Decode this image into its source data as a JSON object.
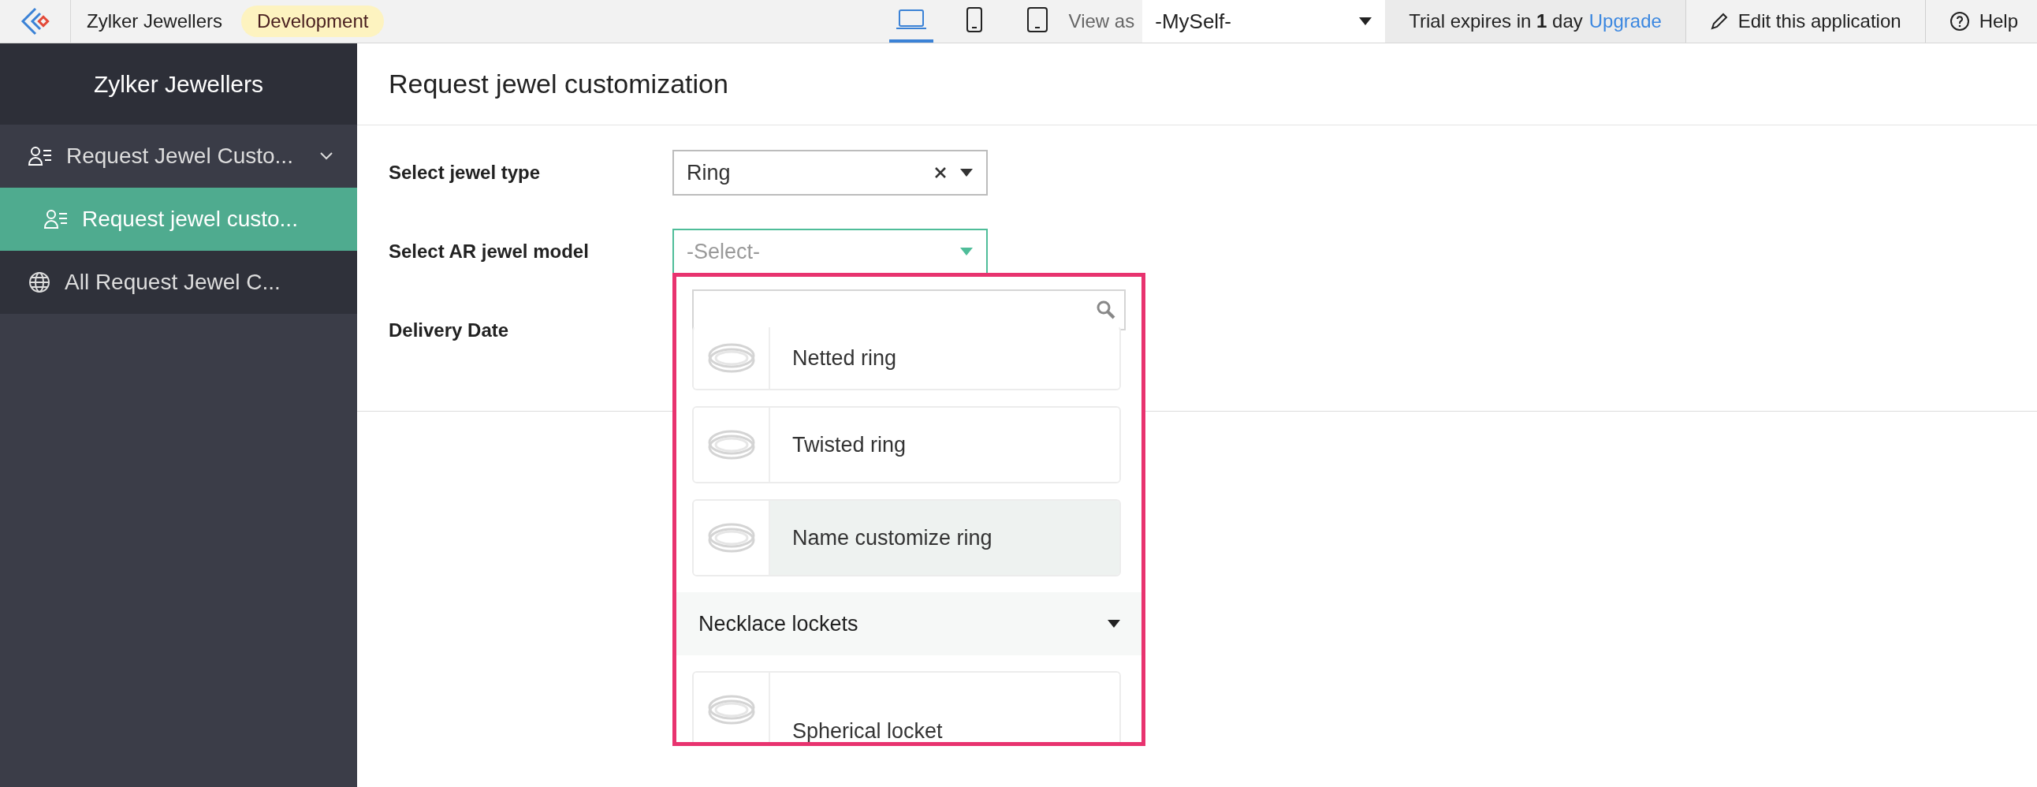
{
  "topbar": {
    "app_name": "Zylker Jewellers",
    "environment": "Development",
    "devices": [
      {
        "kind": "laptop",
        "selected": true
      },
      {
        "kind": "phone",
        "selected": false
      },
      {
        "kind": "tablet",
        "selected": false
      }
    ],
    "view_as_label": "View as",
    "view_as_value": "-MySelf-",
    "trial_text": "Trial expires in **1** day",
    "upgrade_link": "Upgrade",
    "edit_button": "Edit this application",
    "help_button": "Help"
  },
  "sidebar": {
    "title": "Zylker Jewellers",
    "items": [
      {
        "label": "Request Jewel Custo...",
        "kind": "form",
        "selected": false,
        "expanded": true,
        "children": [
          {
            "label": "Request jewel custo...",
            "kind": "form",
            "selected": true
          }
        ]
      },
      {
        "label": "All Request Jewel C...",
        "kind": "report",
        "selected": false
      }
    ]
  },
  "form": {
    "title": "Request jewel customization",
    "fields": [
      {
        "label": "Select jewel type",
        "kind": "select",
        "value": "Ring",
        "focused": false
      },
      {
        "label": "Select AR jewel model",
        "kind": "select",
        "placeholder": "-Select-",
        "focused": true
      },
      {
        "label": "Delivery Date",
        "kind": "covered"
      }
    ]
  },
  "dropdown": {
    "options": [
      {
        "kind": "option",
        "label": "Netted ring",
        "highlighted": false
      },
      {
        "kind": "option",
        "label": "Twisted ring",
        "highlighted": false
      },
      {
        "kind": "option",
        "label": "Name customize ring",
        "highlighted": true
      },
      {
        "kind": "group",
        "label": "Necklace lockets",
        "expanded": true
      },
      {
        "kind": "option",
        "label": "Spherical locket",
        "highlighted": false
      }
    ]
  }
}
